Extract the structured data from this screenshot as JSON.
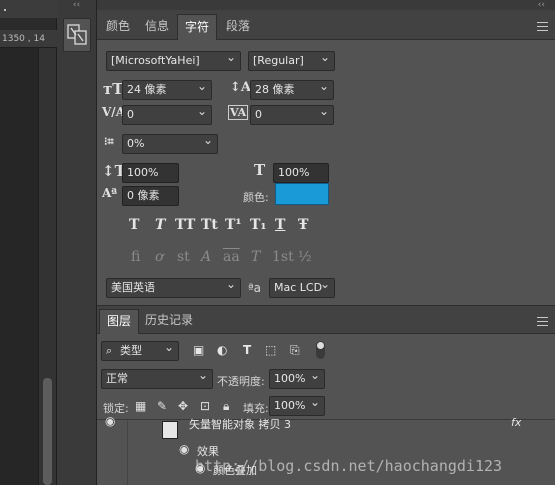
{
  "ruler": {
    "text": "1350 , 14"
  },
  "char_tabs": [
    "颜色",
    "信息",
    "字符",
    "段落"
  ],
  "character": {
    "font_family": "[MicrosoftYaHei]",
    "font_style": "[Regular]",
    "font_size": "24 像素",
    "leading": "28 像素",
    "kerning": "0",
    "tracking": "0",
    "tsume": "0%",
    "vertical_scale": "100%",
    "horizontal_scale": "100%",
    "baseline_shift": "0 像素",
    "color_label": "颜色:",
    "color_hex": "#1a9ad6",
    "style_buttons": [
      "T",
      "T",
      "TT",
      "Tt",
      "T¹",
      "T₁",
      "T",
      "Ŧ"
    ],
    "opentype_buttons": [
      "ﬁ",
      "ơ",
      "st",
      "A",
      "aa",
      "T",
      "1st",
      "½"
    ],
    "language": "美国英语",
    "aa_symbol": "ªa",
    "antialias": "Mac LCD"
  },
  "layer_tabs": [
    "图层",
    "历史记录"
  ],
  "layers": {
    "filter_kind": "类型",
    "blend_mode": "正常",
    "opacity_label": "不透明度:",
    "opacity": "100%",
    "lock_label": "锁定:",
    "fill_label": "填充:",
    "fill": "100%",
    "layer_name": "矢量智能对象 拷贝 3",
    "fx_label": "fx",
    "effects_label": "效果",
    "effect_item": "颜色叠加"
  },
  "watermark": "http://blog.csdn.net/haochangdi123"
}
